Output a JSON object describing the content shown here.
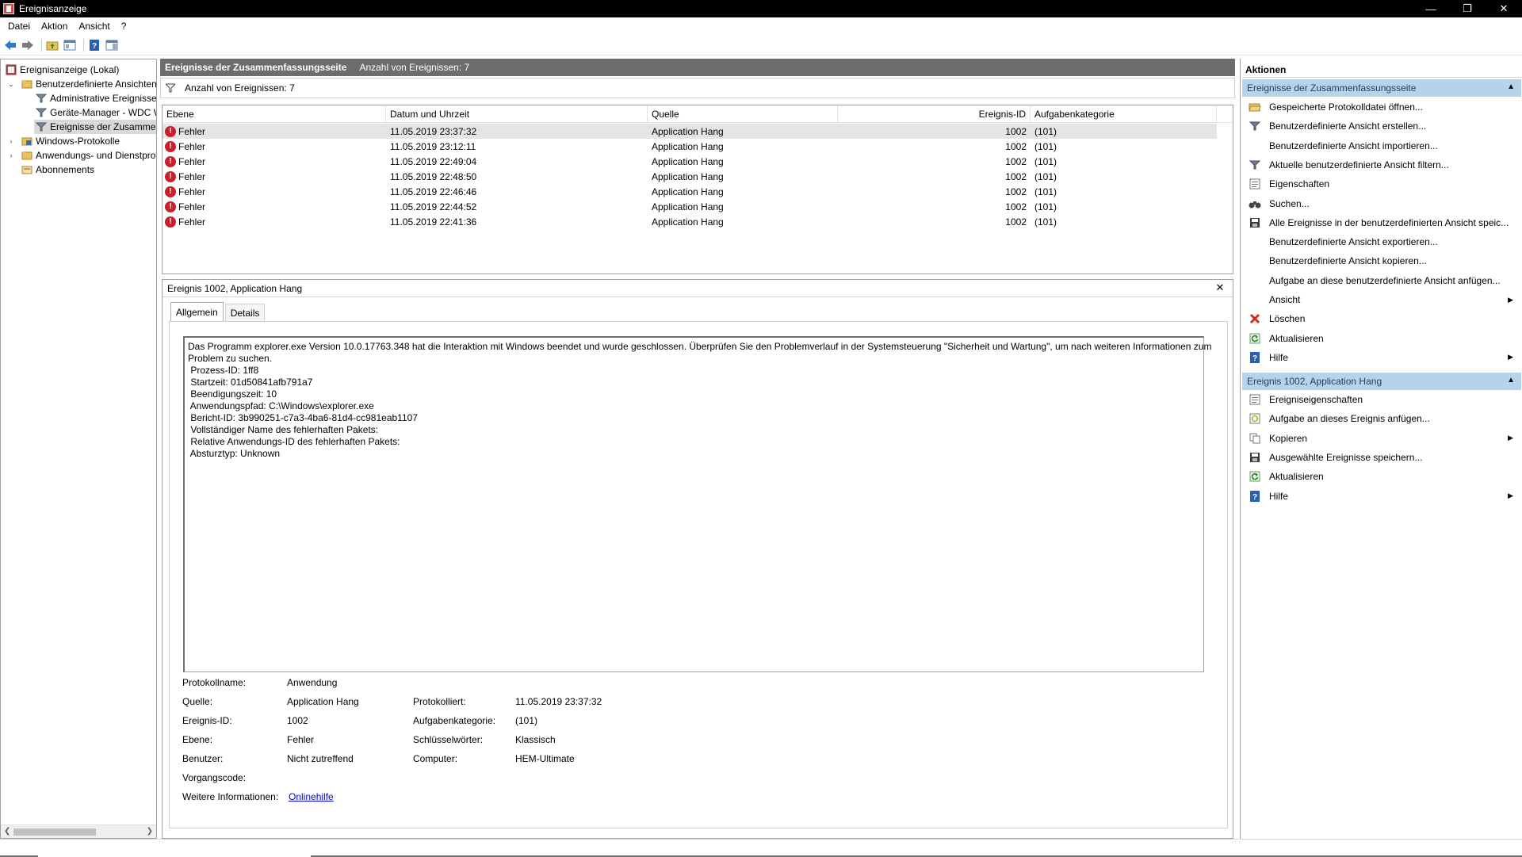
{
  "window": {
    "title": "Ereignisanzeige",
    "minimize": "—",
    "restore": "❐",
    "close": "✕"
  },
  "menu": [
    "Datei",
    "Aktion",
    "Ansicht",
    "?"
  ],
  "tree": {
    "items": [
      {
        "label": "Ereignisanzeige (Lokal)"
      },
      {
        "label": "Benutzerdefinierte Ansichten"
      },
      {
        "label": "Administrative Ereignisse"
      },
      {
        "label": "Geräte-Manager - WDC WD"
      },
      {
        "label": "Ereignisse der Zusammenfassungsseite"
      },
      {
        "label": "Windows-Protokolle"
      },
      {
        "label": "Anwendungs- und Dienstprotokolle"
      },
      {
        "label": "Abonnements"
      }
    ]
  },
  "center": {
    "header_title": "Ereignisse der Zusammenfassungsseite",
    "header_count": "Anzahl von Ereignissen: 7",
    "filter_text": "Anzahl von Ereignissen: 7",
    "columns": [
      "Ebene",
      "Datum und Uhrzeit",
      "Quelle",
      "Ereignis-ID",
      "Aufgabenkategorie"
    ],
    "rows": [
      {
        "level": "Fehler",
        "date": "11.05.2019 23:37:32",
        "source": "Application Hang",
        "id": "1002",
        "cat": "(101)"
      },
      {
        "level": "Fehler",
        "date": "11.05.2019 23:12:11",
        "source": "Application Hang",
        "id": "1002",
        "cat": "(101)"
      },
      {
        "level": "Fehler",
        "date": "11.05.2019 22:49:04",
        "source": "Application Hang",
        "id": "1002",
        "cat": "(101)"
      },
      {
        "level": "Fehler",
        "date": "11.05.2019 22:48:50",
        "source": "Application Hang",
        "id": "1002",
        "cat": "(101)"
      },
      {
        "level": "Fehler",
        "date": "11.05.2019 22:46:46",
        "source": "Application Hang",
        "id": "1002",
        "cat": "(101)"
      },
      {
        "level": "Fehler",
        "date": "11.05.2019 22:44:52",
        "source": "Application Hang",
        "id": "1002",
        "cat": "(101)"
      },
      {
        "level": "Fehler",
        "date": "11.05.2019 22:41:36",
        "source": "Application Hang",
        "id": "1002",
        "cat": "(101)"
      }
    ]
  },
  "detail": {
    "title": "Ereignis 1002, Application Hang",
    "close": "✕",
    "tabs": [
      "Allgemein",
      "Details"
    ],
    "message_lines": [
      "Das Programm explorer.exe Version 10.0.17763.348 hat die Interaktion mit Windows beendet und wurde geschlossen. Überprüfen Sie den Problemverlauf in der Systemsteuerung \"Sicherheit und Wartung\", um nach weiteren Informationen zum",
      "Problem zu suchen.",
      " Prozess-ID: 1ff8",
      " Startzeit: 01d50841afb791a7",
      " Beendigungszeit: 10",
      " Anwendungspfad: C:\\Windows\\explorer.exe",
      " Bericht-ID: 3b990251-c7a3-4ba6-81d4-cc981eab1107",
      " Vollständiger Name des fehlerhaften Pakets:",
      " Relative Anwendungs-ID des fehlerhaften Pakets:",
      " Absturztyp: Unknown"
    ],
    "props": {
      "protokollname_label": "Protokollname:",
      "protokollname": "Anwendung",
      "quelle_label": "Quelle:",
      "quelle": "Application Hang",
      "protokolliert_label": "Protokolliert:",
      "protokolliert": "11.05.2019 23:37:32",
      "ereignisid_label": "Ereignis-ID:",
      "ereignisid": "1002",
      "aufgabenkategorie_label": "Aufgabenkategorie:",
      "aufgabenkategorie": "(101)",
      "ebene_label": "Ebene:",
      "ebene": "Fehler",
      "schluesselwoerter_label": "Schlüsselwörter:",
      "schluesselwoerter": "Klassisch",
      "benutzer_label": "Benutzer:",
      "benutzer": "Nicht zutreffend",
      "computer_label": "Computer:",
      "computer": "HEM-Ultimate",
      "vorgangscode_label": "Vorgangscode:",
      "weitere_label": "Weitere Informationen:",
      "weitere_link": "Onlinehilfe"
    }
  },
  "actions": {
    "title": "Aktionen",
    "section1": {
      "title": "Ereignisse der Zusammenfassungsseite",
      "items": [
        {
          "label": "Gespeicherte Protokolldatei öffnen...",
          "icon": "folder-open-icon"
        },
        {
          "label": "Benutzerdefinierte Ansicht erstellen...",
          "icon": "filter-create-icon"
        },
        {
          "label": "Benutzerdefinierte Ansicht importieren...",
          "icon": ""
        },
        {
          "label": "Aktuelle benutzerdefinierte Ansicht filtern...",
          "icon": "filter-icon"
        },
        {
          "label": "Eigenschaften",
          "icon": "properties-icon"
        },
        {
          "label": "Suchen...",
          "icon": "binoculars-icon"
        },
        {
          "label": "Alle Ereignisse in der benutzerdefinierten Ansicht speic...",
          "icon": "save-icon"
        },
        {
          "label": "Benutzerdefinierte Ansicht exportieren...",
          "icon": ""
        },
        {
          "label": "Benutzerdefinierte Ansicht kopieren...",
          "icon": ""
        },
        {
          "label": "Aufgabe an diese benutzerdefinierte Ansicht anfügen...",
          "icon": ""
        },
        {
          "label": "Ansicht",
          "icon": "",
          "submenu": "▶"
        },
        {
          "label": "Löschen",
          "icon": "delete-icon"
        },
        {
          "label": "Aktualisieren",
          "icon": "refresh-icon"
        },
        {
          "label": "Hilfe",
          "icon": "help-icon",
          "submenu": "▶"
        }
      ]
    },
    "section2": {
      "title": "Ereignis 1002, Application Hang",
      "items": [
        {
          "label": "Ereigniseigenschaften",
          "icon": "event-properties-icon"
        },
        {
          "label": "Aufgabe an dieses Ereignis anfügen...",
          "icon": "task-icon"
        },
        {
          "label": "Kopieren",
          "icon": "copy-icon",
          "submenu": "▶"
        },
        {
          "label": "Ausgewählte Ereignisse speichern...",
          "icon": "save-icon"
        },
        {
          "label": "Aktualisieren",
          "icon": "refresh-icon"
        },
        {
          "label": "Hilfe",
          "icon": "help-icon",
          "submenu": "▶"
        }
      ]
    },
    "caret": "▲"
  }
}
